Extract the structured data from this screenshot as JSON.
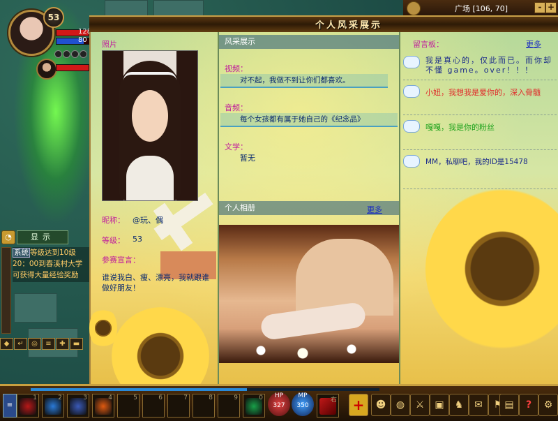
{
  "hud": {
    "level": "53",
    "hp_value": "128",
    "mp_value": "80",
    "hp_fraction": 1.0,
    "mp_fraction": 0.85,
    "location": "广场 [106, 70]",
    "map_zoom_out": "-",
    "map_zoom_in": "+"
  },
  "chat": {
    "tab_label": "显示",
    "system_tag": "系统",
    "lines": [
      "等级达到10级",
      "20：00到春溪村大学",
      "可获得大量经验奖励"
    ]
  },
  "profile_window": {
    "title": "个人风采展示",
    "photo": {
      "header": "照片"
    },
    "info": {
      "nickname_label": "昵称：",
      "nickname_value": "@玩、偶",
      "level_label": "等级：",
      "level_value": "53",
      "declaration_label": "参赛宣言：",
      "declaration_value": "谁说我白、瘦、漂亮，我就跟谁做好朋友！"
    },
    "showcase": {
      "header": "风采展示",
      "video_label": "视频：",
      "video_text": "对不起，我做不到让你们都喜欢。",
      "audio_label": "音频：",
      "audio_text": "每个女孩都有属于她自己的《纪念品》",
      "literature_label": "文学：",
      "literature_text": "暂无"
    },
    "album": {
      "header": "个人相册",
      "more": "更多"
    },
    "message_board": {
      "header": "留言板：",
      "more": "更多",
      "messages": [
        {
          "text": "我是真心的，仅此而已。而你却不懂 game。over！！！",
          "color": "#1a2a8a"
        },
        {
          "text": "小妞，我想我是爱你的，深入骨髓",
          "color": "#e02a2a"
        },
        {
          "text": "嘎嘎，我是你的粉丝",
          "color": "#18a018"
        },
        {
          "text": "MM，私聊吧，我的ID是15478",
          "color": "#1a2a8a"
        }
      ]
    }
  },
  "hotbar": {
    "exp_fraction": 0.62,
    "slots": [
      {
        "num": "1",
        "icon": "blood-skill-icon",
        "color": "#b81818"
      },
      {
        "num": "2",
        "icon": "ice-skill-icon",
        "color": "#2a7ad8"
      },
      {
        "num": "3",
        "icon": "wind-skill-icon",
        "color": "#3a5ab8"
      },
      {
        "num": "4",
        "icon": "fire-skill-icon",
        "color": "#e05a10"
      },
      {
        "num": "5",
        "icon": "",
        "color": ""
      },
      {
        "num": "6",
        "icon": "",
        "color": ""
      },
      {
        "num": "7",
        "icon": "",
        "color": ""
      },
      {
        "num": "8",
        "icon": "",
        "color": ""
      },
      {
        "num": "9",
        "icon": "",
        "color": ""
      },
      {
        "num": "0",
        "icon": "jade-skill-icon",
        "color": "#18a048"
      }
    ],
    "hp_potion_label": "HP",
    "hp_potion_count": "327",
    "mp_potion_label": "MP",
    "mp_potion_count": "350",
    "extra_slot_label": "右",
    "system_buttons": [
      "add-friend-icon",
      "character-icon",
      "bag-icon",
      "skills-icon",
      "team-icon",
      "pet-icon",
      "quest-icon",
      "guild-icon",
      "book-icon",
      "help-icon",
      "settings-icon"
    ]
  }
}
